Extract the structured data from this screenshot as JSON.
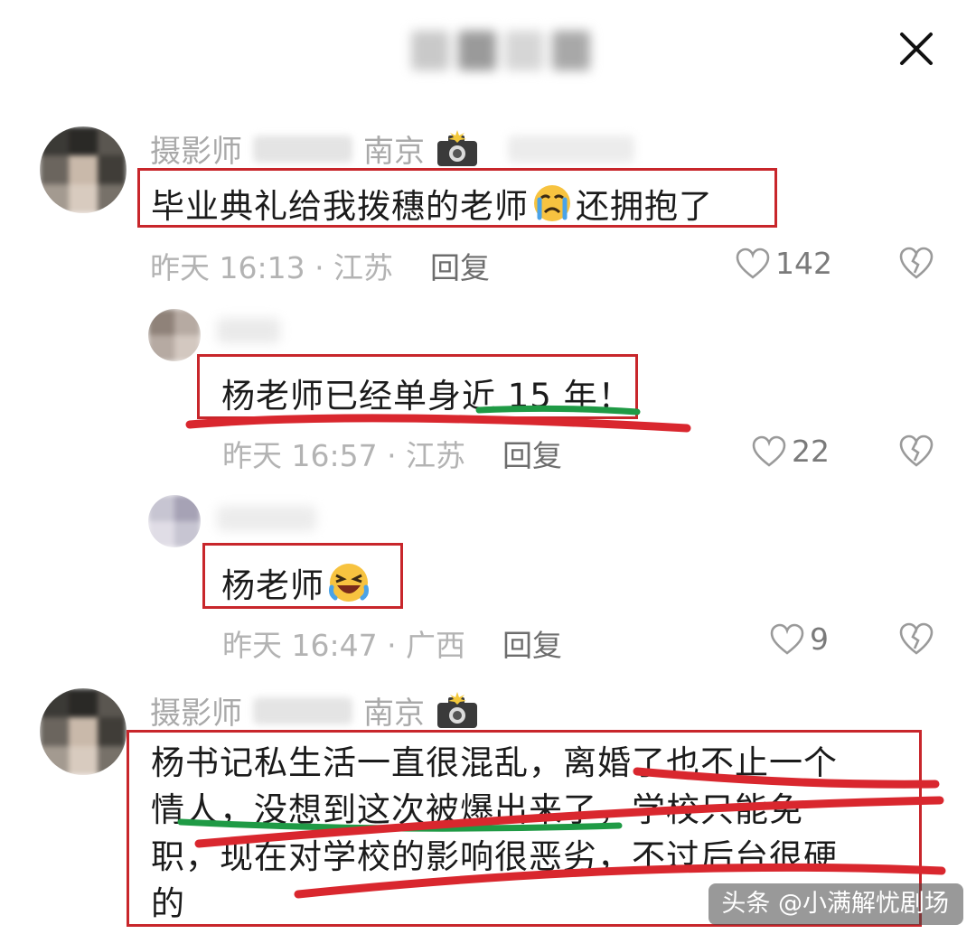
{
  "header": {
    "close_icon": "close-icon"
  },
  "comments": [
    {
      "user": "摄影师",
      "city": "南京",
      "badge": "camera-icon",
      "text": "毕业典礼给我拨穗的老师",
      "emoji": "crying-face-icon",
      "text_tail": "还拥抱了",
      "time": "昨天 16:13 · 江苏",
      "reply": "回复",
      "likes": "142"
    },
    {
      "text": "杨老师已经单身近 15 年！",
      "time": "昨天 16:57 · 江苏",
      "reply": "回复",
      "likes": "22"
    },
    {
      "text": "杨老师",
      "emoji": "rolling-laughing-face-icon",
      "time": "昨天 16:47 · 广西",
      "reply": "回复",
      "likes": "9"
    },
    {
      "user": "摄影师",
      "city": "南京",
      "badge": "camera-icon",
      "line1": "杨书记私生活一直很混乱，离婚了也不止一个",
      "line2": "情人，没想到这次被爆出来了，学校只能免",
      "line3": "职，现在对学校的影响很恶劣，不过后台很硬",
      "line4": "的"
    }
  ],
  "watermark": "头条 @小满解忧剧场",
  "colors": {
    "box_red": "#c8262b",
    "underline_red": "#d9272e",
    "underline_green": "#1f9a45"
  }
}
